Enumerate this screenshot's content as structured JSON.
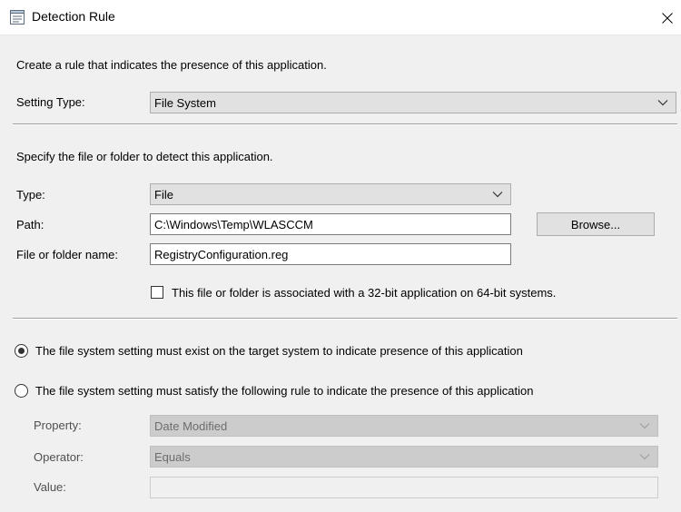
{
  "window": {
    "title": "Detection Rule",
    "icon": "rule-list-icon"
  },
  "intro": "Create a rule that indicates the presence of this application.",
  "setting_type": {
    "label": "Setting Type:",
    "value": "File System"
  },
  "file_section": {
    "heading": "Specify the file or folder to detect this application.",
    "type_label": "Type:",
    "type_value": "File",
    "path_label": "Path:",
    "path_value": "C:\\Windows\\Temp\\WLASCCM",
    "browse_label": "Browse...",
    "name_label": "File or folder name:",
    "name_value": "RegistryConfiguration.reg",
    "checkbox_label": "This file or folder is associated with a 32-bit application on 64-bit systems.",
    "checkbox_checked": false
  },
  "options": {
    "exist_label": "The file system setting must exist on the target system to indicate presence of this application",
    "exist_selected": true,
    "rule_label": "The file system setting must satisfy the following rule to indicate the presence of this application",
    "rule_selected": false
  },
  "rule": {
    "property_label": "Property:",
    "property_value": "Date Modified",
    "operator_label": "Operator:",
    "operator_value": "Equals",
    "value_label": "Value:",
    "value_value": ""
  }
}
